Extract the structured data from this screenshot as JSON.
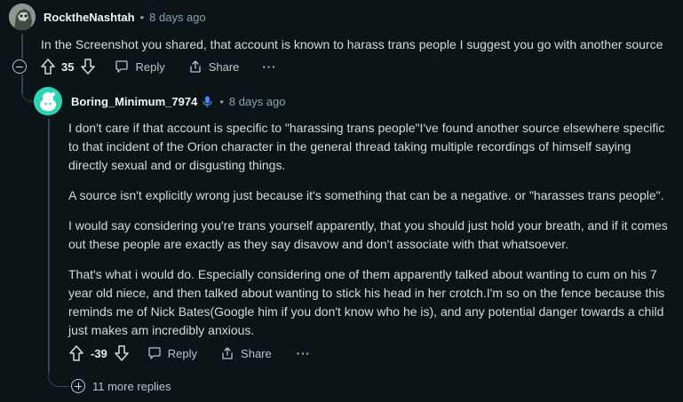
{
  "comment1": {
    "username": "RocktheNashtah",
    "separator": "•",
    "time": "8 days ago",
    "body": "In the Screenshot you shared, that account is known to harass trans people I suggest you go with another source",
    "score": "35",
    "reply_label": "Reply",
    "share_label": "Share",
    "more_label": "···"
  },
  "comment2": {
    "username": "Boring_Minimum_7974",
    "separator": "•",
    "time": "8 days ago",
    "paragraphs": [
      [
        "I don't care if that account is specific to \"harassing trans people\"I've found another source elsewhere specific",
        "to that incident of the Orion character in the general thread taking multiple recordings of himself saying",
        "directly sexual and or disgusting things."
      ],
      [
        "A source isn't explicitly wrong just because it's something that can be a negative. or \"harasses trans people\"."
      ],
      [
        "I would say considering you're trans yourself apparently, that you should just hold your breath, and if it comes",
        "out these people are exactly as they say disavow and don't associate with that whatsoever."
      ],
      [
        "That's what i would do. Especially considering one of them apparently talked about wanting to cum on his 7",
        "year old niece, and then talked about wanting to stick his head in her crotch.I'm so on the fence because this",
        "reminds me of Nick Bates(Google him if you don't know who he is), and any potential danger towards a child",
        "just makes am incredibly anxious."
      ]
    ],
    "score": "-39",
    "reply_label": "Reply",
    "share_label": "Share",
    "more_label": "···"
  },
  "more_replies": "11 more replies"
}
